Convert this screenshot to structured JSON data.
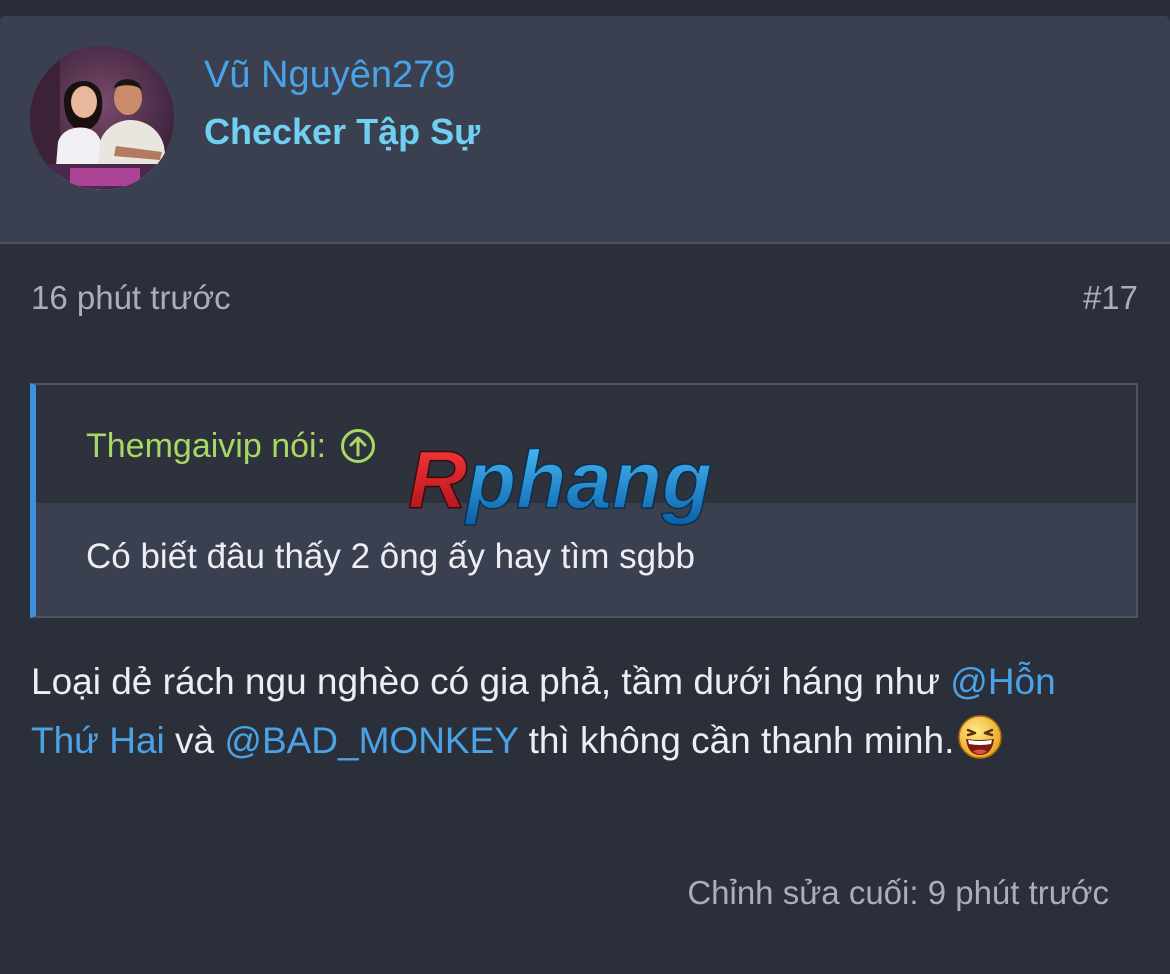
{
  "user": {
    "username": "Vũ Nguyên279",
    "title": "Checker Tập Sự"
  },
  "post": {
    "time": "16 phút trước",
    "number": "#17",
    "quote": {
      "author": "Themgaivip nói:",
      "text": "Có biết đâu thấy 2 ông ấy hay tìm sgbb"
    },
    "message": {
      "part1": "Loại dẻ rách ngu nghèo có gia phả, tầm dưới háng như ",
      "mention1": "@Hỗn Thứ Hai",
      "part2": " và ",
      "mention2": "@BAD_MONKEY",
      "part3": " thì không cần thanh minh."
    },
    "edited": "Chỉnh sửa cuối: 9 phút trước"
  },
  "watermark": {
    "text": "Rphang"
  },
  "colors": {
    "background": "#2b2f3a",
    "card": "#3a4050",
    "username": "#4aa3e6",
    "user_title": "#6fd0f2",
    "quote_author": "#a6d863",
    "quote_bar": "#3d8fe0",
    "mention": "#4aa3e6",
    "muted_text": "#a9aeb8",
    "body_text": "#eceef2"
  },
  "icons": {
    "quote_jump": "arrow-up-circle-icon",
    "emoji": "laughing-emoji-icon",
    "avatar": "user-avatar-photo"
  }
}
